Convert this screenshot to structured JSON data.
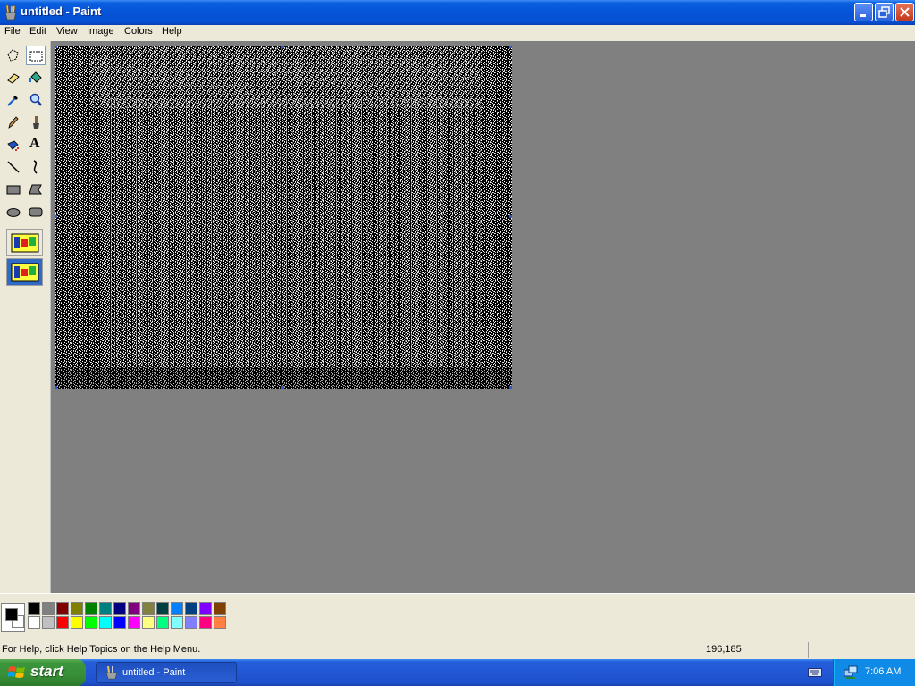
{
  "window": {
    "title": "untitled - Paint",
    "buttons": [
      "minimize",
      "restore",
      "close"
    ]
  },
  "menu": {
    "items": [
      "File",
      "Edit",
      "View",
      "Image",
      "Colors",
      "Help"
    ]
  },
  "toolbox": {
    "tools": [
      {
        "name": "free-form-select",
        "icon": "free-form-select-icon"
      },
      {
        "name": "select",
        "icon": "rect-select-icon",
        "selected": true
      },
      {
        "name": "eraser",
        "icon": "eraser-icon"
      },
      {
        "name": "fill-with-color",
        "icon": "fill-bucket-icon"
      },
      {
        "name": "pick-color",
        "icon": "eyedropper-icon"
      },
      {
        "name": "magnifier",
        "icon": "magnifier-icon"
      },
      {
        "name": "pencil",
        "icon": "pencil-icon"
      },
      {
        "name": "brush",
        "icon": "brush-icon"
      },
      {
        "name": "airbrush",
        "icon": "airbrush-icon"
      },
      {
        "name": "text",
        "icon": "text-icon",
        "label": "A"
      },
      {
        "name": "line",
        "icon": "line-icon"
      },
      {
        "name": "curve",
        "icon": "curve-icon"
      },
      {
        "name": "rectangle",
        "icon": "rectangle-icon"
      },
      {
        "name": "polygon",
        "icon": "polygon-icon"
      },
      {
        "name": "ellipse",
        "icon": "ellipse-icon"
      },
      {
        "name": "rounded-rectangle",
        "icon": "rounded-rectangle-icon"
      }
    ],
    "options": [
      "opaque-selection-icon",
      "transparent-selection-icon"
    ]
  },
  "palette": {
    "foreground": "#000000",
    "background": "#ffffff",
    "colors_row1": [
      "#000000",
      "#808080",
      "#800000",
      "#808000",
      "#008000",
      "#008080",
      "#000080",
      "#800080",
      "#808040",
      "#004040",
      "#0080ff",
      "#004080",
      "#8000ff",
      "#804000"
    ],
    "colors_row2": [
      "#ffffff",
      "#c0c0c0",
      "#ff0000",
      "#ffff00",
      "#00ff00",
      "#00ffff",
      "#0000ff",
      "#ff00ff",
      "#ffff80",
      "#00ff80",
      "#80ffff",
      "#8080ff",
      "#ff0080",
      "#ff8040"
    ]
  },
  "status": {
    "help_text": "For Help, click Help Topics on the Help Menu.",
    "coordinates": "196,185"
  },
  "taskbar": {
    "start_label": "start",
    "task_label": "untitled - Paint",
    "clock": "7:06 AM"
  }
}
